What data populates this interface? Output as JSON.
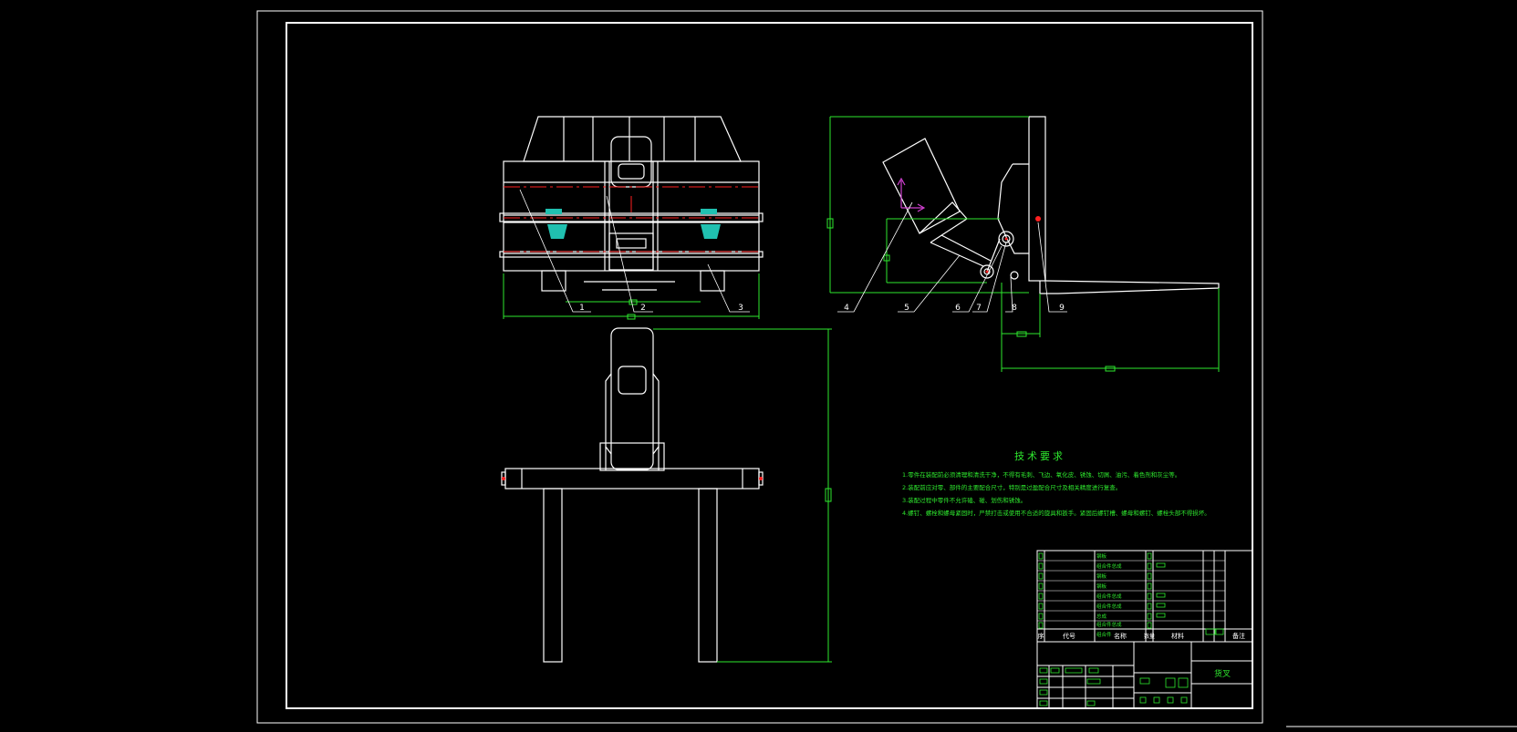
{
  "canvas": {
    "background": "#000000",
    "line_color": "#ffffff",
    "dim_color": "#2ee82e",
    "center_color": "#ff2020",
    "hatch_color": "#20c0b0",
    "ucs_color": "#d040d0"
  },
  "balloons": {
    "front_view": [
      "1",
      "2",
      "3"
    ],
    "side_view": [
      "4",
      "5",
      "6",
      "7",
      "8",
      "9"
    ]
  },
  "tech_requirements": {
    "title": "技术要求",
    "items": [
      "1.零件在装配前必须清理和清洗干净，不得有毛刺、飞边、氧化皮、锈蚀、切屑、油污、着色剂和灰尘等。",
      "2.装配前应对零、部件的主要配合尺寸，特别是过盈配合尺寸及相关精度进行复查。",
      "3.装配过程中零件不允许磕、碰、划伤和锈蚀。",
      "4.螺钉、螺栓和螺母紧固时，严禁打击或使用不合适的旋具和扳手。紧固后螺钉槽、螺母和螺钉、螺栓头部不得损坏。"
    ]
  },
  "title_block": {
    "bom_rows": [
      {
        "name": "钢板"
      },
      {
        "name": "组合件总成"
      },
      {
        "name": "钢板"
      },
      {
        "name": "钢板"
      },
      {
        "name": "组合件总成"
      },
      {
        "name": "组合件总成"
      },
      {
        "name": "总成"
      },
      {
        "name": "组合件总成"
      },
      {
        "name": "组合件"
      }
    ],
    "header": {
      "seq": "序",
      "code": "代号",
      "name": "名称",
      "qty": "数量",
      "material": "材料",
      "note": "备注"
    },
    "drawing_title": "货叉"
  }
}
